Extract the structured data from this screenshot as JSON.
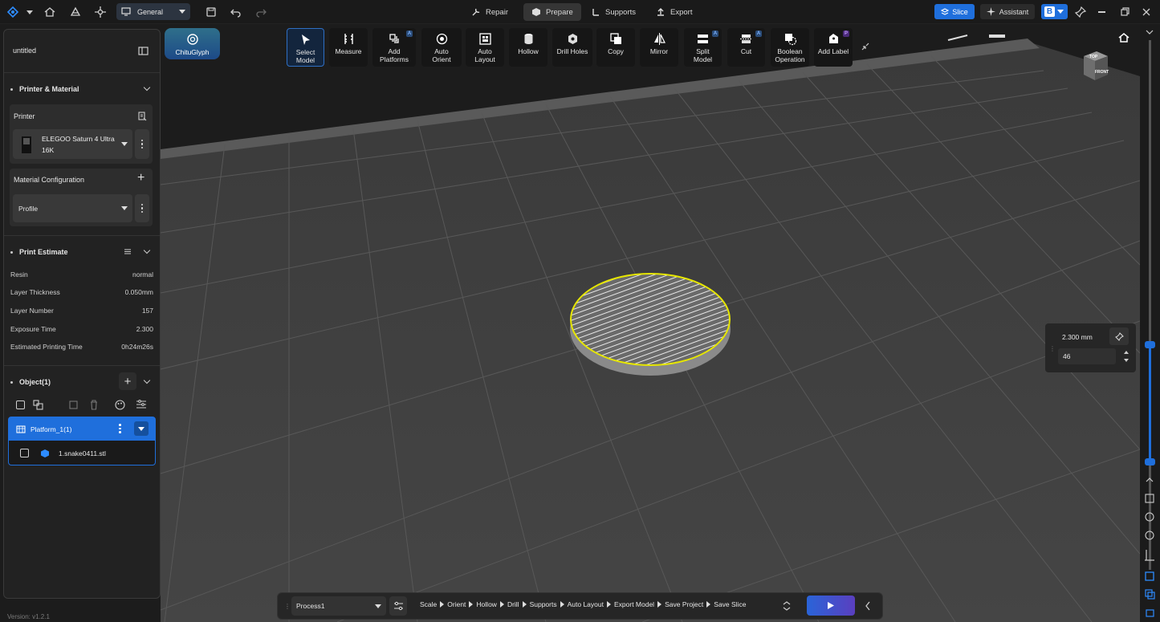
{
  "topbar": {
    "workspace": "General",
    "modes": [
      {
        "label": "Repair",
        "active": false
      },
      {
        "label": "Prepare",
        "active": true
      },
      {
        "label": "Supports",
        "active": false
      },
      {
        "label": "Export",
        "active": false
      }
    ],
    "slice_label": "Slice",
    "assistant_label": "Assistant",
    "b_label": "B"
  },
  "left_panel": {
    "file_name": "untitled",
    "printer_material_title": "Printer & Material",
    "printer_label": "Printer",
    "printer_name_line1": "ELEGOO Saturn 4 Ultra",
    "printer_name_line2": "16K",
    "material_config_label": "Material Configuration",
    "profile_label": "Profile",
    "print_estimate_title": "Print Estimate",
    "estimates": [
      {
        "label": "Resin",
        "value": "normal"
      },
      {
        "label": "Layer Thickness",
        "value": "0.050mm"
      },
      {
        "label": "Layer Number",
        "value": "157"
      },
      {
        "label": "Exposure Time",
        "value": "2.300"
      },
      {
        "label": "Estimated Printing Time",
        "value": "0h24m26s"
      }
    ],
    "object_title": "Object(1)",
    "platform_label": "Platform_1(1)",
    "model_file": "1.snake0411.stl",
    "version": "Version: v1.2.1"
  },
  "chitu_label": "ChituGlyph",
  "tools": [
    {
      "line1": "Select",
      "line2": "Model"
    },
    {
      "line1": "Measure",
      "line2": ""
    },
    {
      "line1": "Add",
      "line2": "Platforms"
    },
    {
      "line1": "Auto",
      "line2": "Orient"
    },
    {
      "line1": "Auto",
      "line2": "Layout"
    },
    {
      "line1": "Hollow",
      "line2": ""
    },
    {
      "line1": "Drill Holes",
      "line2": ""
    },
    {
      "line1": "Copy",
      "line2": ""
    },
    {
      "line1": "Mirror",
      "line2": ""
    },
    {
      "line1": "Split",
      "line2": "Model"
    },
    {
      "line1": "Cut",
      "line2": ""
    },
    {
      "line1": "Boolean",
      "line2": "Operation"
    },
    {
      "line1": "Add Label",
      "line2": ""
    }
  ],
  "badges": {
    "a": "A",
    "p": "P"
  },
  "layer": {
    "height": "2.300 mm",
    "index": "46"
  },
  "viewcube": {
    "top": "TOP",
    "front": "FRONT"
  },
  "process": {
    "selected": "Process1",
    "steps": [
      "Scale",
      "Orient",
      "Hollow",
      "Drill",
      "Supports",
      "Auto Layout",
      "Export Model",
      "Save Project",
      "Save Slice"
    ]
  },
  "colors": {
    "accent": "#1f6fdc",
    "selection": "#e6e600",
    "panel": "#222222"
  }
}
